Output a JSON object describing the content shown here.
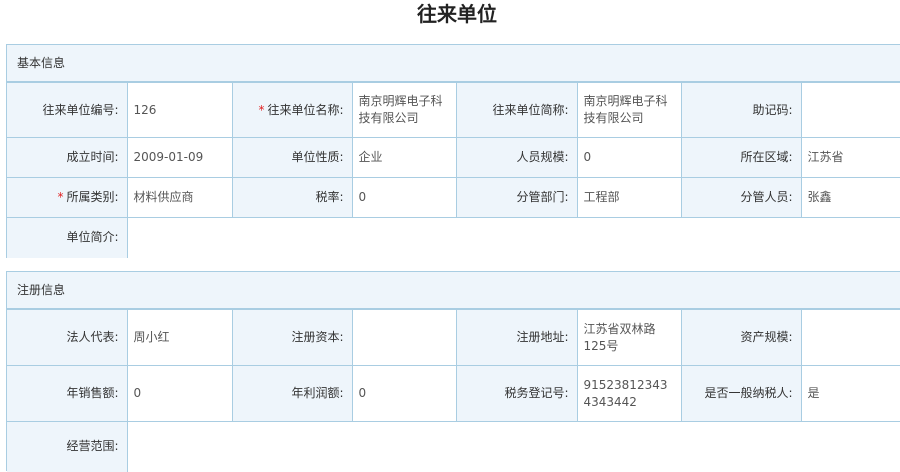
{
  "page": {
    "title": "往来单位"
  },
  "basic": {
    "header": "基本信息",
    "labels": {
      "code": "往来单位编号:",
      "name": "往来单位名称:",
      "short_name": "往来单位简称:",
      "mnemonic": "助记码:",
      "founded": "成立时间:",
      "nature": "单位性质:",
      "staff_size": "人员规模:",
      "region": "所在区域:",
      "category": "所属类别:",
      "tax_rate": "税率:",
      "dept": "分管部门:",
      "manager": "分管人员:",
      "intro": "单位简介:"
    },
    "values": {
      "code": "126",
      "name": "南京明辉电子科技有限公司",
      "short_name": "南京明辉电子科技有限公司",
      "mnemonic": "",
      "founded": "2009-01-09",
      "nature": "企业",
      "staff_size": "0",
      "region": "江苏省",
      "category": "材料供应商",
      "tax_rate": "0",
      "dept": "工程部",
      "manager": "张鑫",
      "intro": ""
    },
    "required_mark": "*"
  },
  "registration": {
    "header": "注册信息",
    "labels": {
      "legal_rep": "法人代表:",
      "capital": "注册资本:",
      "address": "注册地址:",
      "asset_size": "资产规模:",
      "annual_sales": "年销售额:",
      "annual_profit": "年利润额:",
      "tax_reg_no": "税务登记号:",
      "general_taxpayer": "是否一般纳税人:",
      "business_scope": "经营范围:"
    },
    "values": {
      "legal_rep": "周小红",
      "capital": "",
      "address": "江苏省双林路125号",
      "asset_size": "",
      "annual_sales": "0",
      "annual_profit": "0",
      "tax_reg_no": "915238123434343442",
      "general_taxpayer": "是",
      "business_scope": ""
    }
  }
}
